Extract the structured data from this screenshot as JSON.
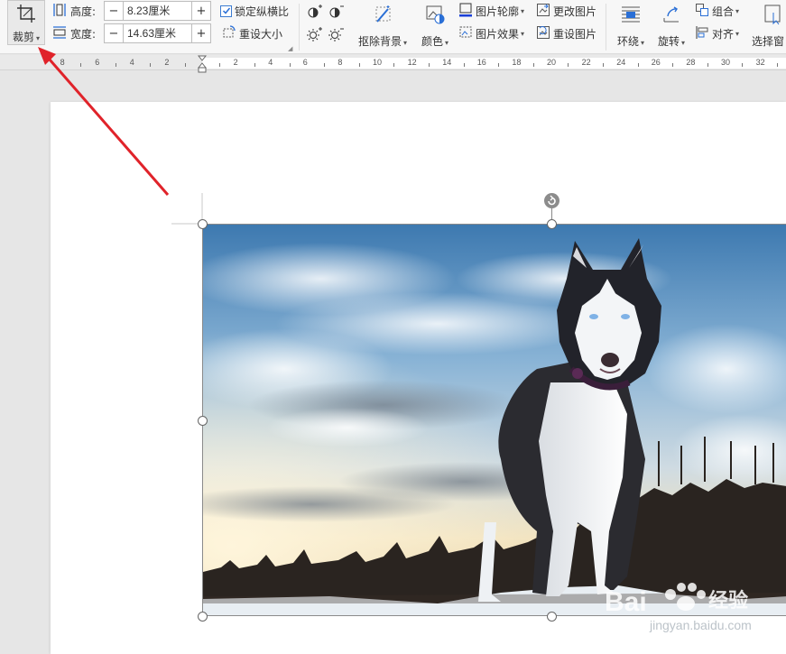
{
  "toolbar": {
    "crop": {
      "label": "裁剪"
    },
    "height": {
      "label": "高度:",
      "value": "8.23厘米",
      "minus": "−",
      "plus": "+"
    },
    "width": {
      "label": "宽度:",
      "value": "14.63厘米",
      "minus": "−",
      "plus": "+"
    },
    "lock_ratio": {
      "label": "锁定纵横比",
      "checked": true
    },
    "reset_size": {
      "label": "重设大小"
    },
    "remove_background": {
      "label": "抠除背景"
    },
    "color": {
      "label": "颜色"
    },
    "picture_outline": {
      "label": "图片轮廓"
    },
    "picture_effects": {
      "label": "图片效果"
    },
    "change_picture": {
      "label": "更改图片"
    },
    "reset_picture": {
      "label": "重设图片"
    },
    "wrap": {
      "label": "环绕"
    },
    "rotate": {
      "label": "旋转"
    },
    "group": {
      "label": "组合"
    },
    "align": {
      "label": "对齐"
    },
    "selection_pane": {
      "label": "选择窗"
    }
  },
  "ruler": {
    "labels_left": [
      "8",
      "6",
      "4",
      "2"
    ],
    "labels_right": [
      "2",
      "4",
      "6",
      "8",
      "10",
      "12",
      "14",
      "16",
      "18",
      "20",
      "22",
      "24",
      "26",
      "28",
      "30",
      "32"
    ]
  },
  "watermark": {
    "brand": "Bai",
    "brand2": "经验",
    "url": "jingyan.baidu.com"
  },
  "colors": {
    "accent": "#2a6fd6",
    "arrow": "#e0232a",
    "ribbon_bg": "#f7f7f7"
  }
}
